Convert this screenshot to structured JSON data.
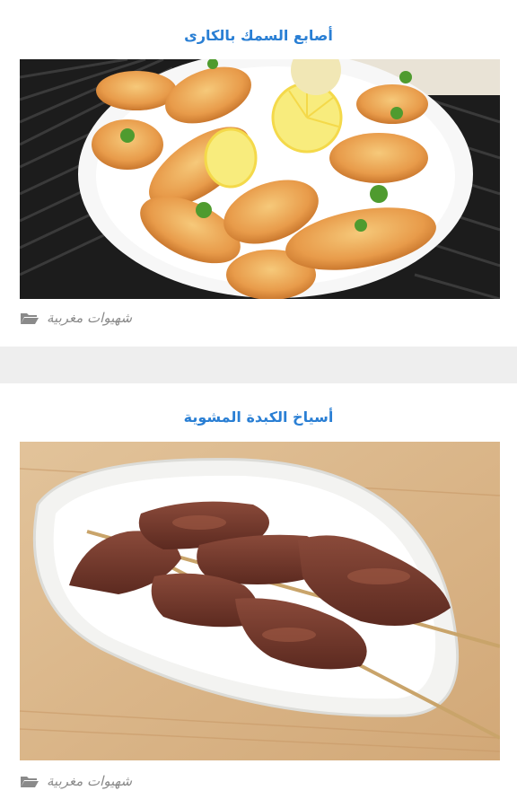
{
  "posts": [
    {
      "title": "أصابع السمك بالكارى",
      "image_alt": "fish-fingers-curry-photo",
      "category": "شهيوات مغربية",
      "icon": "folder-icon"
    },
    {
      "title": "أسياخ الكبدة المشوية",
      "image_alt": "grilled-liver-skewers-photo",
      "category": "شهيوات مغربية",
      "icon": "folder-icon"
    }
  ],
  "colors": {
    "title": "#2a7fd4",
    "meta": "#8a8a8a",
    "page_bg": "#eeeeee",
    "card_bg": "#ffffff"
  }
}
